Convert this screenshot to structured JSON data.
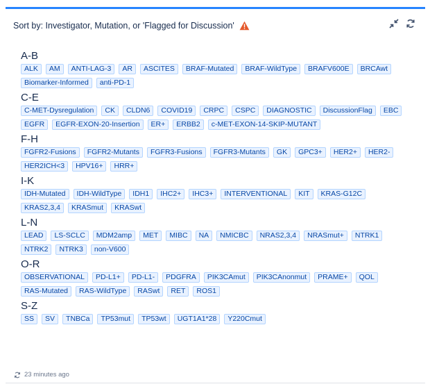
{
  "header": {
    "title": "Sort by: Investigator, Mutation, or 'Flagged for Discussion'"
  },
  "icons": {
    "warning": "warning-icon",
    "collapse": "collapse-icon",
    "refresh": "refresh-icon"
  },
  "groups": [
    {
      "label": "A-B",
      "tags": [
        "ALK",
        "AM",
        "ANTI-LAG-3",
        "AR",
        "ASCITES",
        "BRAF-Mutated",
        "BRAF-WildType",
        "BRAFV600E",
        "BRCAwt",
        "Biomarker-Informed",
        "anti-PD-1"
      ]
    },
    {
      "label": "C-E",
      "tags": [
        "C-MET-Dysregulation",
        "CK",
        "CLDN6",
        "COVID19",
        "CRPC",
        "CSPC",
        "DIAGNOSTIC",
        "DiscussionFlag",
        "EBC",
        "EGFR",
        "EGFR-EXON-20-Insertion",
        "ER+",
        "ERBB2",
        "c-MET-EXON-14-SKIP-MUTANT"
      ]
    },
    {
      "label": "F-H",
      "tags": [
        "FGFR2-Fusions",
        "FGFR2-Mutants",
        "FGFR3-Fusions",
        "FGFR3-Mutants",
        "GK",
        "GPC3+",
        "HER2+",
        "HER2-",
        "HER2ICH<3",
        "HPV16+",
        "HRR+"
      ]
    },
    {
      "label": "I-K",
      "tags": [
        "IDH-Mutated",
        "IDH-WildType",
        "IDH1",
        "IHC2+",
        "IHC3+",
        "INTERVENTIONAL",
        "KIT",
        "KRAS-G12C",
        "KRAS2,3,4",
        "KRASmut",
        "KRASwt"
      ]
    },
    {
      "label": "L-N",
      "tags": [
        "LEAD",
        "LS-SCLC",
        "MDM2amp",
        "MET",
        "MIBC",
        "NA",
        "NMICBC",
        "NRAS2,3,4",
        "NRASmut+",
        "NTRK1",
        "NTRK2",
        "NTRK3",
        "non-V600"
      ]
    },
    {
      "label": "O-R",
      "tags": [
        "OBSERVATIONAL",
        "PD-L1+",
        "PD-L1-",
        "PDGFRA",
        "PIK3CAmut",
        "PIK3CAnonmut",
        "PRAME+",
        "QOL",
        "RAS-Mutated",
        "RAS-WildType",
        "RASwt",
        "RET",
        "ROS1"
      ]
    },
    {
      "label": "S-Z",
      "tags": [
        "SS",
        "SV",
        "TNBCa",
        "TP53mut",
        "TP53wt",
        "UGT1A1*28",
        "Y220Cmut"
      ]
    }
  ],
  "footer": {
    "updated": "23 minutes ago"
  },
  "colors": {
    "accent": "#2684ff",
    "tag_bg": "#e9f2ff",
    "tag_border": "#b3d4ff",
    "tag_text": "#0747a6",
    "warning": "#e5582a"
  }
}
